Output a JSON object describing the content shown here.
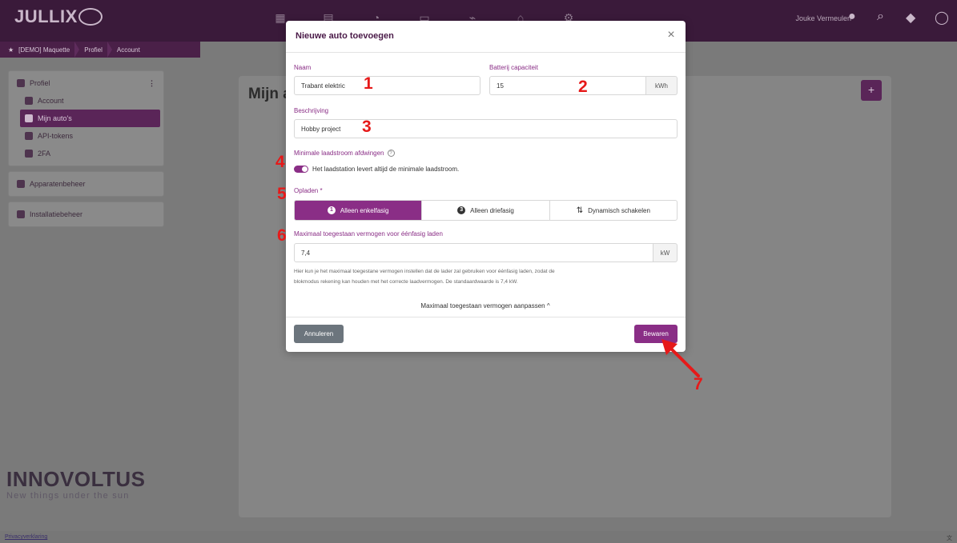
{
  "app": {
    "user": "Jouke Vermeulen",
    "breadcrumb": [
      "[DEMO] Maquette",
      "Profiel",
      "Account"
    ],
    "brand": "INNOVOLTUS",
    "brand_tagline": "New things under the sun",
    "footer_link": "Privacyverklaring"
  },
  "sidebar": {
    "sections": [
      {
        "label": "Profiel",
        "items": [
          "Account",
          "Mijn auto's",
          "API-tokens",
          "2FA"
        ],
        "active": "Mijn auto's"
      },
      {
        "label": "Apparatenbeheer"
      },
      {
        "label": "Installatiebeheer"
      }
    ]
  },
  "main": {
    "title": "Mijn a",
    "add_button": "+"
  },
  "modal": {
    "title": "Nieuwe auto toevoegen",
    "close": "×",
    "name": {
      "label": "Naam",
      "value": "Trabant elektric"
    },
    "battery": {
      "label": "Batterij capaciteit",
      "value": "15",
      "unit": "kWh"
    },
    "description": {
      "label": "Beschrijving",
      "value": "Hobby project"
    },
    "min_current": {
      "label": "Minimale laadstroom afdwingen",
      "toggle_label": "Het laadstation levert altijd de minimale laadstroom.",
      "enabled": true
    },
    "charging": {
      "label": "Opladen *",
      "options": [
        "Alleen enkelfasig",
        "Alleen driefasig",
        "Dynamisch schakelen"
      ],
      "option_icons": [
        "1",
        "3",
        ""
      ],
      "selected": 0
    },
    "max_power": {
      "label": "Maximaal toegestaan vermogen voor éénfasig laden",
      "value": "7,4",
      "unit": "kW",
      "help_line1": "Hier kun je het maximaal toegestane vermogen instellen dat de lader zal gebruiken voor éénfasig laden, zodat de",
      "help_line2": "blokmodus rekening kan houden met het correcte laadvermogen. De standaardwaarde is 7,4 kW."
    },
    "collapse_link": "Maximaal toegestaan vermogen aanpassen ^",
    "cancel_label": "Annuleren",
    "save_label": "Bewaren"
  },
  "annotations": [
    "1",
    "2",
    "3",
    "4",
    "5",
    "6",
    "7"
  ],
  "colors": {
    "accent": "#8a2e86",
    "annotation": "#e61919",
    "overlay": "#7a7a7a"
  }
}
